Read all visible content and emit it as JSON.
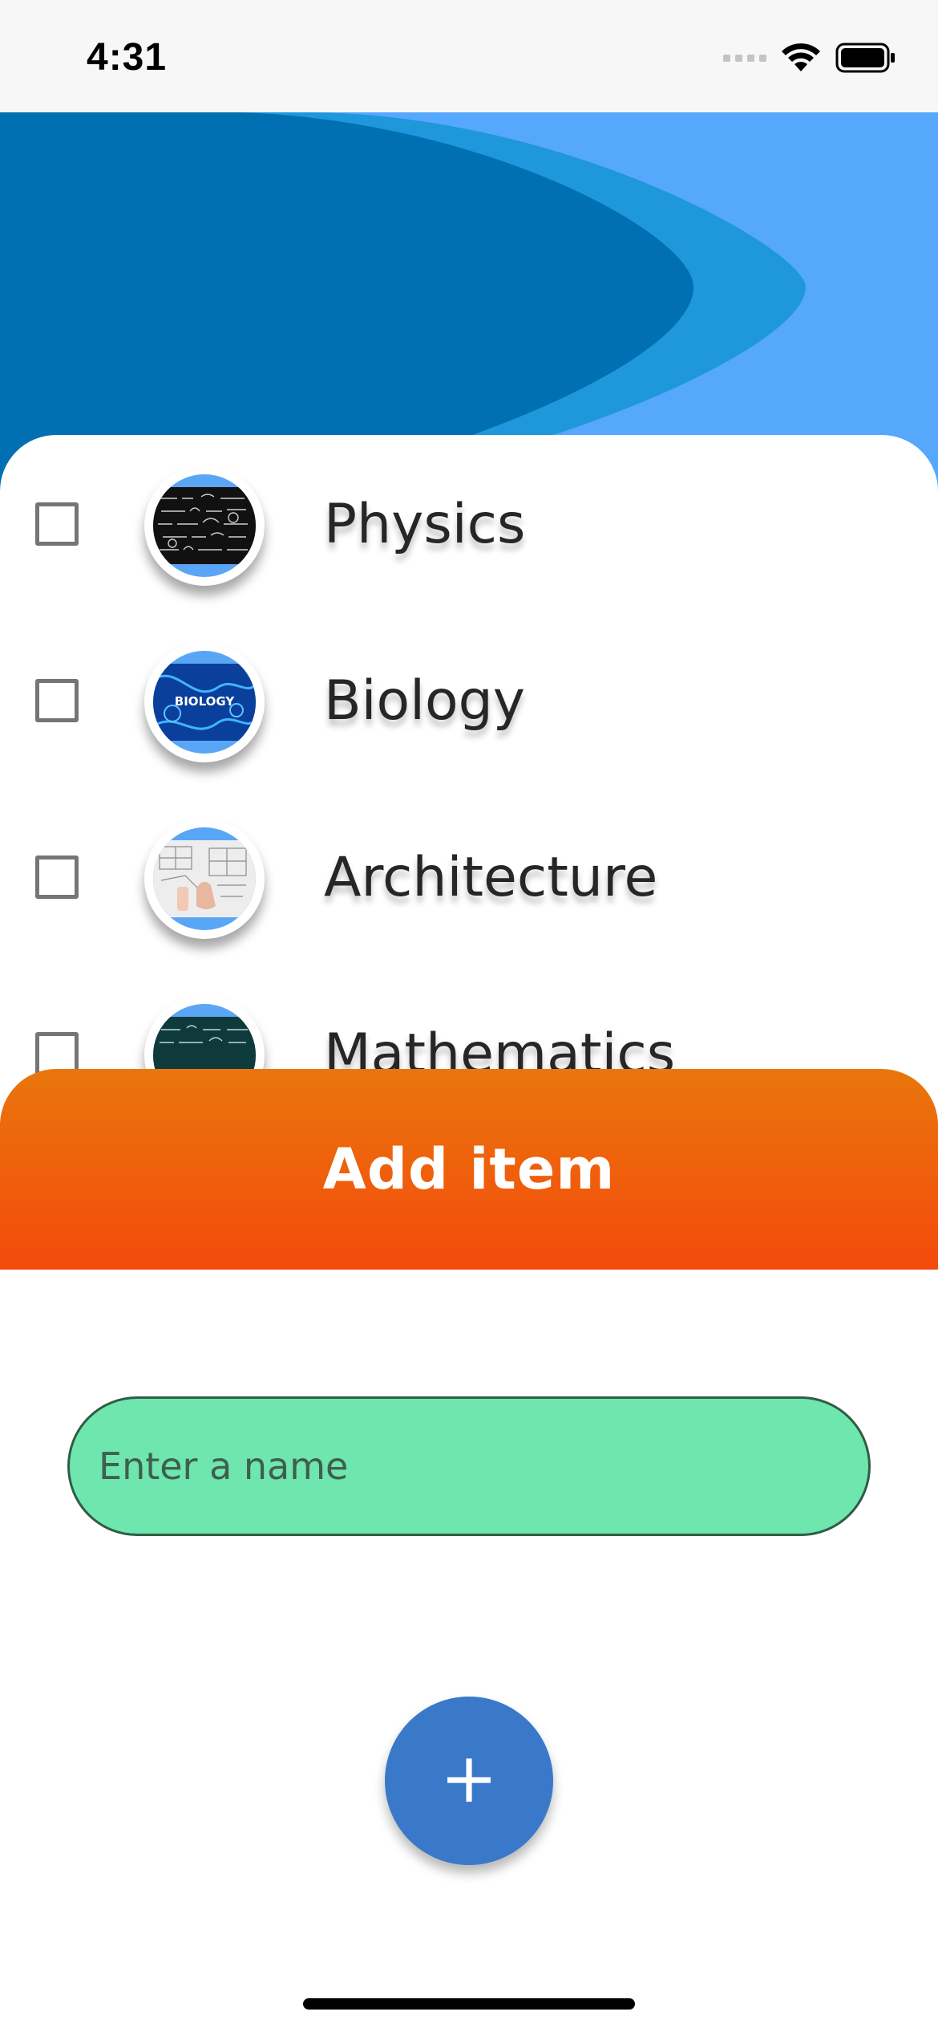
{
  "status_bar": {
    "time": "4:31",
    "icons": [
      "cellular-signal-icon",
      "wifi-icon",
      "battery-icon"
    ]
  },
  "hero": {
    "colors": [
      "#0070b2",
      "#1f97db",
      "#55a8fb"
    ]
  },
  "list": {
    "items": [
      {
        "label": "Physics",
        "checked": false,
        "image": "physics-chalkboard-image"
      },
      {
        "label": "Biology",
        "checked": false,
        "image": "biology-dna-image",
        "image_text": "BIOLOGY"
      },
      {
        "label": "Architecture",
        "checked": false,
        "image": "architecture-blueprint-image"
      },
      {
        "label": "Mathematics",
        "checked": false,
        "image": "mathematics-chalkboard-image"
      }
    ]
  },
  "add_bar": {
    "label": "Add item",
    "colors": [
      "#e9760c",
      "#f44a0c"
    ]
  },
  "name_input": {
    "placeholder": "Enter a name",
    "value": "",
    "color": "#6ee6ad"
  },
  "fab": {
    "label": "+",
    "color": "#3a79c9"
  }
}
